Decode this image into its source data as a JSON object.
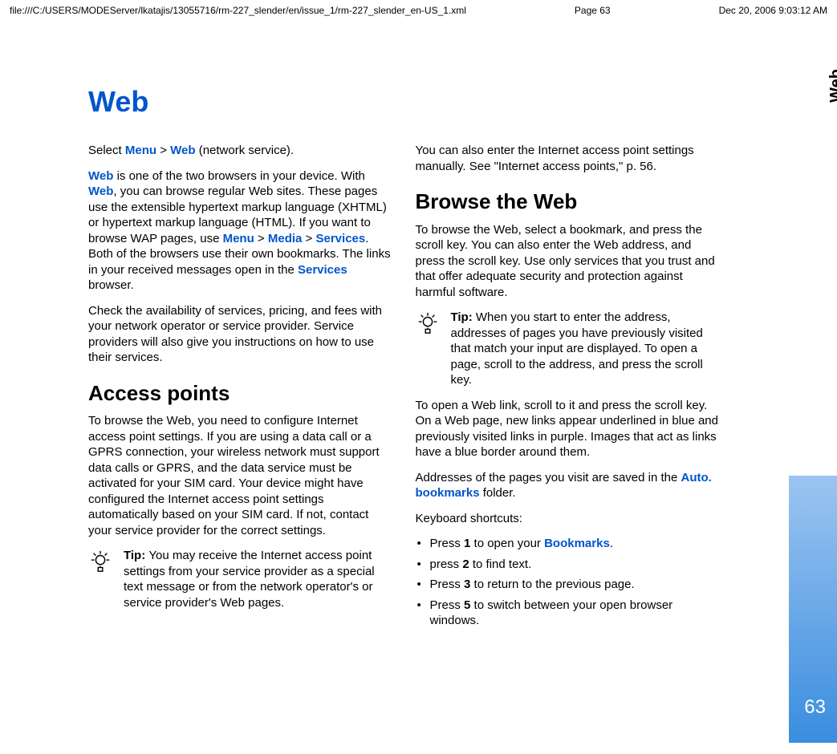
{
  "header": {
    "path": "file:///C:/USERS/MODEServer/lkatajis/13055716/rm-227_slender/en/issue_1/rm-227_slender_en-US_1.xml",
    "page": "Page 63",
    "datetime": "Dec 20, 2006 9:03:12 AM"
  },
  "title": "Web",
  "side_label": "Web",
  "page_number": "63",
  "col1": {
    "intro_select": "Select ",
    "menu": "Menu",
    "gt": " > ",
    "web": "Web",
    "intro_tail": " (network service).",
    "p1a": "Web",
    "p1b": " is one of the two browsers in your device. With ",
    "p1c": "Web",
    "p1d": ", you can browse regular Web sites. These pages use the extensible hypertext markup language (XHTML) or hypertext markup language (HTML). If you want to browse WAP pages, use ",
    "p1e": "Menu",
    "p1f": " > ",
    "p1g": "Media",
    "p1h": " > ",
    "p1i": "Services",
    "p1j": ". Both of the browsers use their own bookmarks. The links in your received messages open in the ",
    "p1k": "Services",
    "p1l": " browser.",
    "p2": "Check the availability of services, pricing, and fees with your network operator or service provider. Service providers will also give you instructions on how to use their services.",
    "h2": "Access points",
    "p3": "To browse the Web, you need to configure Internet access point settings. If you are using a data call or a GPRS connection, your wireless network must support data calls or GPRS, and the data service must be activated for your SIM card. Your device might have configured the Internet access point settings automatically based on your SIM card. If not, contact your service provider for the correct settings.",
    "tip_label": "Tip: ",
    "tip_text": "You may receive the Internet access point settings from your service provider as a special text message or from the network operator's or service provider's Web pages."
  },
  "col2": {
    "p1": "You can also enter the Internet access point settings manually. See \"Internet access points,\" p. 56.",
    "h2": "Browse the Web",
    "p2": "To browse the Web, select a bookmark, and press the scroll key. You can also enter the Web address, and press the scroll key. Use only services that you trust and that offer adequate security and protection against harmful software.",
    "tip_label": "Tip: ",
    "tip_text": "When you start to enter the address, addresses of pages you have previously visited that match your input are displayed. To open a page, scroll to the address, and press the scroll key.",
    "p3": "To open a Web link, scroll to it and press the scroll key. On a Web page, new links appear underlined in blue and previously visited links in purple. Images that act as links have a blue border around them.",
    "p4a": "Addresses of the pages you visit are saved in the ",
    "p4b": "Auto. bookmarks",
    "p4c": " folder.",
    "shortcuts_label": "Keyboard shortcuts:",
    "bullets": {
      "b1a": "Press ",
      "b1b": "1",
      "b1c": " to open your ",
      "b1d": "Bookmarks",
      "b1e": ".",
      "b2a": "press ",
      "b2b": "2",
      "b2c": " to find text.",
      "b3a": "Press ",
      "b3b": "3",
      "b3c": " to return to the previous page.",
      "b4a": "Press ",
      "b4b": "5",
      "b4c": " to switch between your open browser windows."
    }
  }
}
